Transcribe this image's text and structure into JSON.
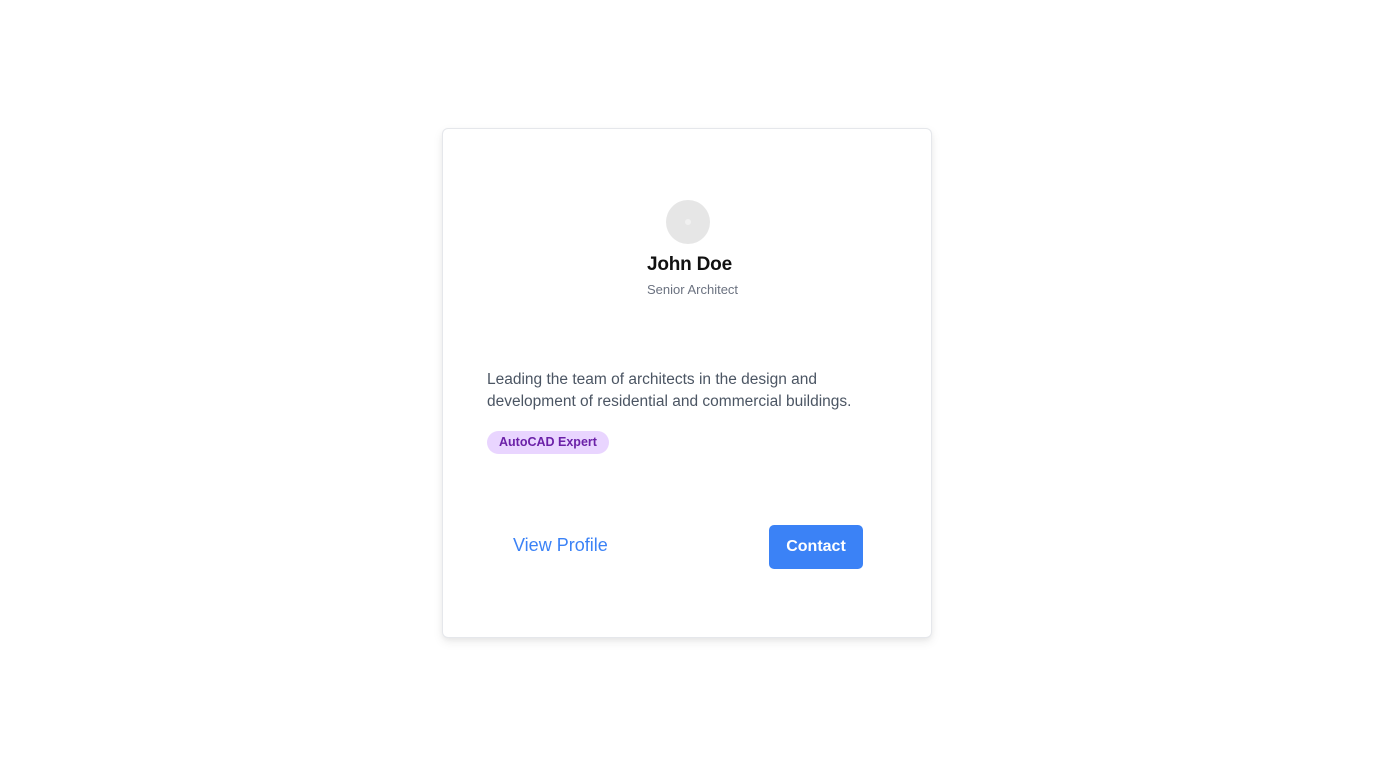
{
  "profile": {
    "name": "John Doe",
    "role": "Senior Architect",
    "bio": "Leading the team of architects in the design and development of residential and commercial buildings.",
    "badge": "AutoCAD Expert"
  },
  "actions": {
    "view_profile_label": "View Profile",
    "contact_label": "Contact"
  },
  "colors": {
    "accent": "#3b82f6",
    "badge_bg": "#e9d5ff",
    "badge_text": "#6b21a8",
    "avatar_bg": "#e6e6e6"
  },
  "icons": {
    "avatar": "avatar-placeholder-icon"
  }
}
